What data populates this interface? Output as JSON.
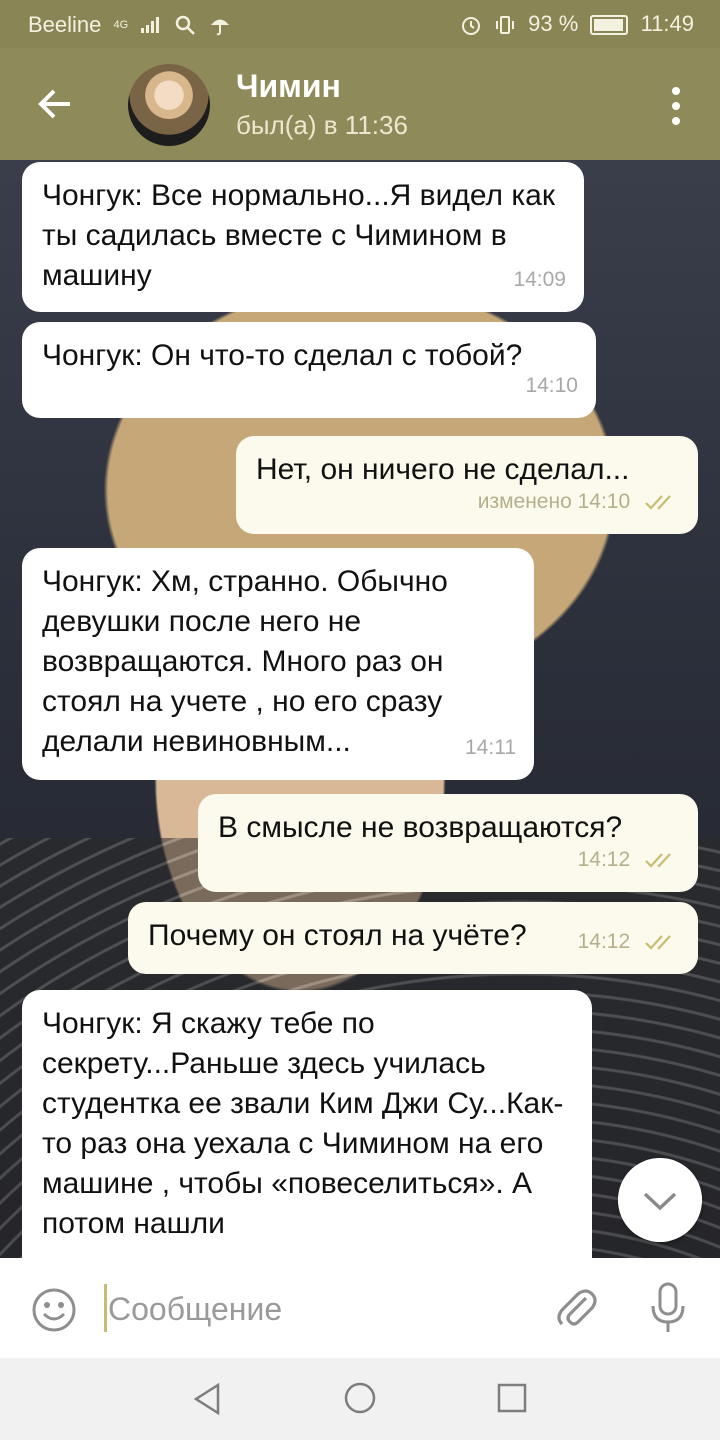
{
  "status_bar": {
    "carrier": "Beeline",
    "network": "4G",
    "battery": "93 %",
    "time": "11:49",
    "icons": [
      "signal-icon",
      "search-icon",
      "umbrella-icon",
      "alarm-icon",
      "vibrate-icon",
      "battery-icon"
    ]
  },
  "header": {
    "contact_name": "Чимин",
    "last_seen": "был(а) в 11:36",
    "icons": [
      "back-arrow-icon",
      "more-vert-icon"
    ]
  },
  "messages": [
    {
      "direction": "in",
      "text": "Чонгук: Все нормально...Я видел как ты садилась вместе с Чимином в машину",
      "time": "14:09"
    },
    {
      "direction": "in",
      "text": "Чонгук: Он что-то сделал с тобой?",
      "time": "14:10"
    },
    {
      "direction": "out",
      "text": "Нет, он ничего не сделал...",
      "time": "изменено 14:10",
      "read": true
    },
    {
      "direction": "in",
      "text": "Чонгук: Хм, странно. Обычно девушки после него не возвращаются. Много раз он стоял на учете , но его сразу делали невиновным...",
      "time": "14:11"
    },
    {
      "direction": "out",
      "text": "В смысле не возвращаются?",
      "time": "14:12",
      "read": true
    },
    {
      "direction": "out",
      "text": "Почему он стоял на учёте?",
      "time": "14:12",
      "read": true
    },
    {
      "direction": "in",
      "text": "Чонгук: Я скажу тебе по секрету...Раньше здесь училась студентка ее звали Ким Джи Су...Как-то раз она уехала с Чимином на его машине , чтобы «повеселиться». А потом нашли",
      "time": ""
    }
  ],
  "composer": {
    "placeholder": "Сообщение",
    "icons": [
      "emoji-icon",
      "attach-icon",
      "mic-icon"
    ]
  },
  "colors": {
    "header": "#8f8a5a",
    "status_bar": "#8a8555",
    "incoming_bubble": "#ffffff",
    "outgoing_bubble": "#fcfaec",
    "read_check": "#c7bd70"
  }
}
